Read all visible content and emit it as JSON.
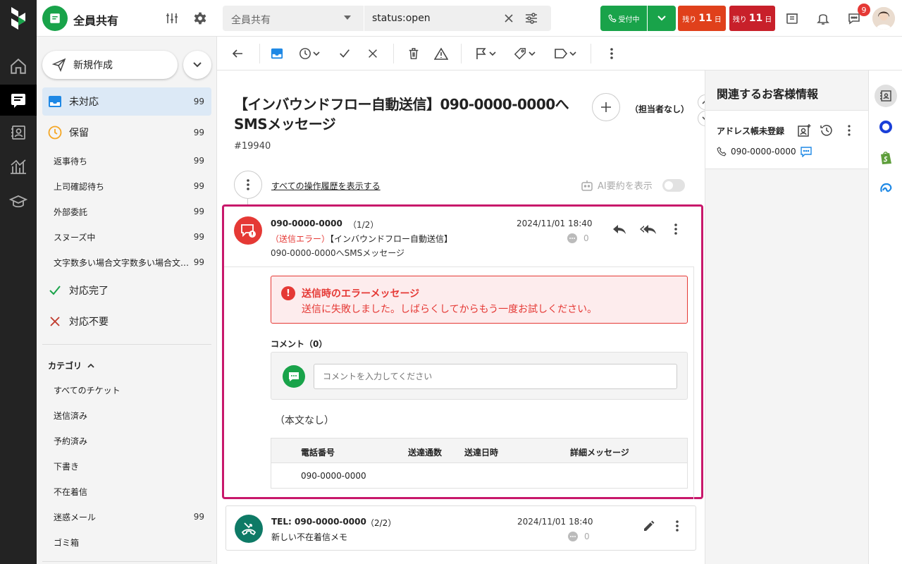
{
  "topbar": {
    "workspace_title": "全員共有",
    "search_scope": "全員共有",
    "search_query": "status:open",
    "reception_label": "受付中",
    "remain_prefix": "残り",
    "remain_days_1": "11",
    "remain_days_2": "11",
    "remain_suffix": "日",
    "notification_count": "9"
  },
  "sidebar": {
    "new_button": "新規作成",
    "main_items": [
      {
        "label": "未対応",
        "count": "99"
      },
      {
        "label": "保留",
        "count": "99"
      }
    ],
    "sub_items": [
      {
        "label": "返事待ち",
        "count": "99"
      },
      {
        "label": "上司確認待ち",
        "count": "99"
      },
      {
        "label": "外部委託",
        "count": "99"
      },
      {
        "label": "スヌーズ中",
        "count": "99"
      },
      {
        "label": "文字数多い場合文字数多い場合文…",
        "count": "99"
      }
    ],
    "done_label": "対応完了",
    "unneeded_label": "対応不要",
    "category_title": "カテゴリ",
    "categories": [
      {
        "label": "すべてのチケット",
        "count": ""
      },
      {
        "label": "送信済み",
        "count": ""
      },
      {
        "label": "予約済み",
        "count": ""
      },
      {
        "label": "下書き",
        "count": ""
      },
      {
        "label": "不在着信",
        "count": ""
      },
      {
        "label": "迷惑メール",
        "count": "99"
      },
      {
        "label": "ゴミ箱",
        "count": ""
      }
    ]
  },
  "ticket": {
    "title": "【インバウンドフロー自動送信】090-0000-0000へSMSメッセージ",
    "number": "#19940",
    "assignee": "（担当者なし）",
    "history_link": "すべての操作履歴を表示する",
    "ai_summary": "AI要約を表示"
  },
  "message1": {
    "from": "090-0000-0000",
    "index": "（1/2）",
    "error_tag": "（送信エラー）",
    "subject_1": "【インバウンドフロー自動送信】",
    "subject_2": "090-0000-0000へSMSメッセージ",
    "date": "2024/11/01 18:40",
    "comment_count": "0",
    "error_title": "送信時のエラーメッセージ",
    "error_body": "送信に失敗しました。しばらくしてからもう一度お試しください。",
    "comment_label": "コメント（0）",
    "comment_placeholder": "コメントを入力してください",
    "no_body": "（本文なし）",
    "table_headers": [
      "電話番号",
      "送達通数",
      "送達日時",
      "詳細メッセージ"
    ],
    "table_row": [
      "090-0000-0000",
      "",
      "",
      ""
    ]
  },
  "message2": {
    "from": "TEL: 090-0000-0000",
    "index": "（2/2）",
    "memo": "新しい不在着信メモ",
    "date": "2024/11/01 18:40",
    "comment_count": "0"
  },
  "customer_panel": {
    "title": "関連するお客様情報",
    "name": "アドレス帳未登録",
    "phone": "090-0000-0000"
  },
  "colors": {
    "brand_green": "#19a34a",
    "error_red": "#e53935",
    "highlight_magenta": "#c8186b",
    "remain_orange": "#e0401b",
    "remain_dark_red": "#c8202a"
  }
}
